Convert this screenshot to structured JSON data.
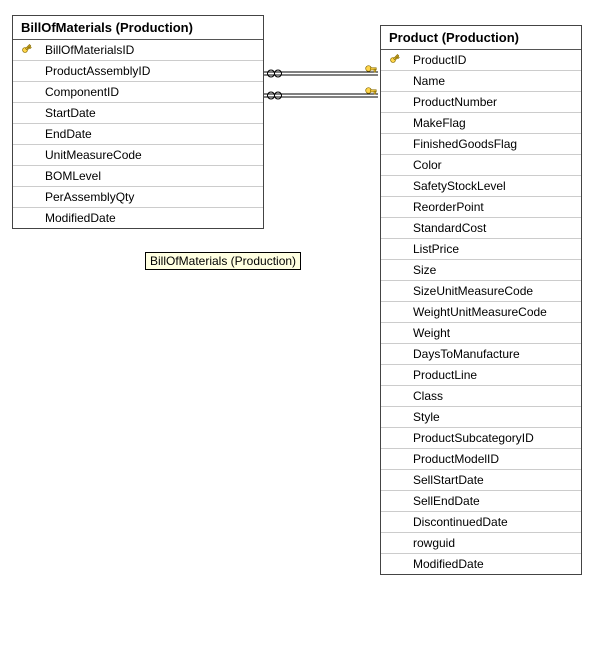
{
  "tables": {
    "bom": {
      "title": "BillOfMaterials (Production)",
      "columns": [
        "BillOfMaterialsID",
        "ProductAssemblyID",
        "ComponentID",
        "StartDate",
        "EndDate",
        "UnitMeasureCode",
        "BOMLevel",
        "PerAssemblyQty",
        "ModifiedDate"
      ],
      "primary_key_indices": [
        0
      ]
    },
    "product": {
      "title": "Product (Production)",
      "columns": [
        "ProductID",
        "Name",
        "ProductNumber",
        "MakeFlag",
        "FinishedGoodsFlag",
        "Color",
        "SafetyStockLevel",
        "ReorderPoint",
        "StandardCost",
        "ListPrice",
        "Size",
        "SizeUnitMeasureCode",
        "WeightUnitMeasureCode",
        "Weight",
        "DaysToManufacture",
        "ProductLine",
        "Class",
        "Style",
        "ProductSubcategoryID",
        "ProductModelID",
        "SellStartDate",
        "SellEndDate",
        "DiscontinuedDate",
        "rowguid",
        "ModifiedDate"
      ],
      "primary_key_indices": [
        0
      ]
    }
  },
  "tooltip": "BillOfMaterials (Production)",
  "relationships": [
    {
      "from_table": "bom",
      "from_column": "ProductAssemblyID",
      "to_table": "product",
      "to_column": "ProductID",
      "child_end": "many",
      "parent_end": "key"
    },
    {
      "from_table": "bom",
      "from_column": "ComponentID",
      "to_table": "product",
      "to_column": "ProductID",
      "child_end": "many",
      "parent_end": "key"
    }
  ]
}
